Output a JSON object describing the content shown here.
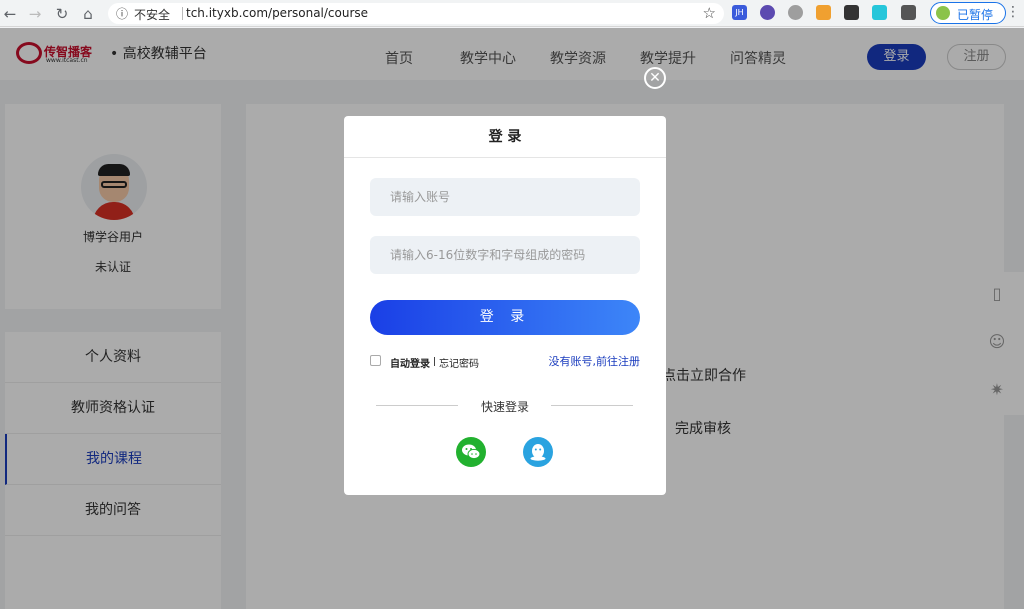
{
  "browser": {
    "back_icon": "←",
    "forward_icon": "→",
    "reload_icon": "↻",
    "home_icon": "⌂",
    "info_icon": "ⓘ",
    "insecure_label": "不安全",
    "url": "tch.ityxb.com/personal/course",
    "star_icon": "☆",
    "ext_jh_label": "JH",
    "profile_label": "已暂停",
    "menu_icon": "⋮"
  },
  "header": {
    "logo_brand": "传智播客",
    "logo_sub": "www.itcast.cn",
    "platform_name": "• 高校教辅平台",
    "nav": [
      "首页",
      "教学中心",
      "教学资源",
      "教学提升",
      "问答精灵"
    ],
    "login_label": "登录",
    "register_label": "注册"
  },
  "profile": {
    "name": "博学谷用户",
    "status": "未认证"
  },
  "side_menu": {
    "items": [
      {
        "label": "个人资料"
      },
      {
        "label": "教师资格认证"
      },
      {
        "label": "我的课程"
      },
      {
        "label": "我的问答"
      }
    ],
    "active_index": 2
  },
  "content": {
    "text1": "点击立即合作",
    "text2": "完成审核"
  },
  "modal": {
    "close_icon": "✕",
    "title": "登 录",
    "account_placeholder": "请输入账号",
    "password_placeholder": "请输入6-16位数字和字母组成的密码",
    "submit_label": "登 录",
    "auto_login_label": "自动登录",
    "forgot_label": "忘记密码",
    "register_link": "没有账号,前往注册",
    "quick_login_label": "快速登录"
  },
  "colors": {
    "brand_blue": "#1a3cbe",
    "wechat_green": "#22b12f",
    "qq_blue": "#2aa3e0",
    "logo_red": "#c8102e"
  }
}
